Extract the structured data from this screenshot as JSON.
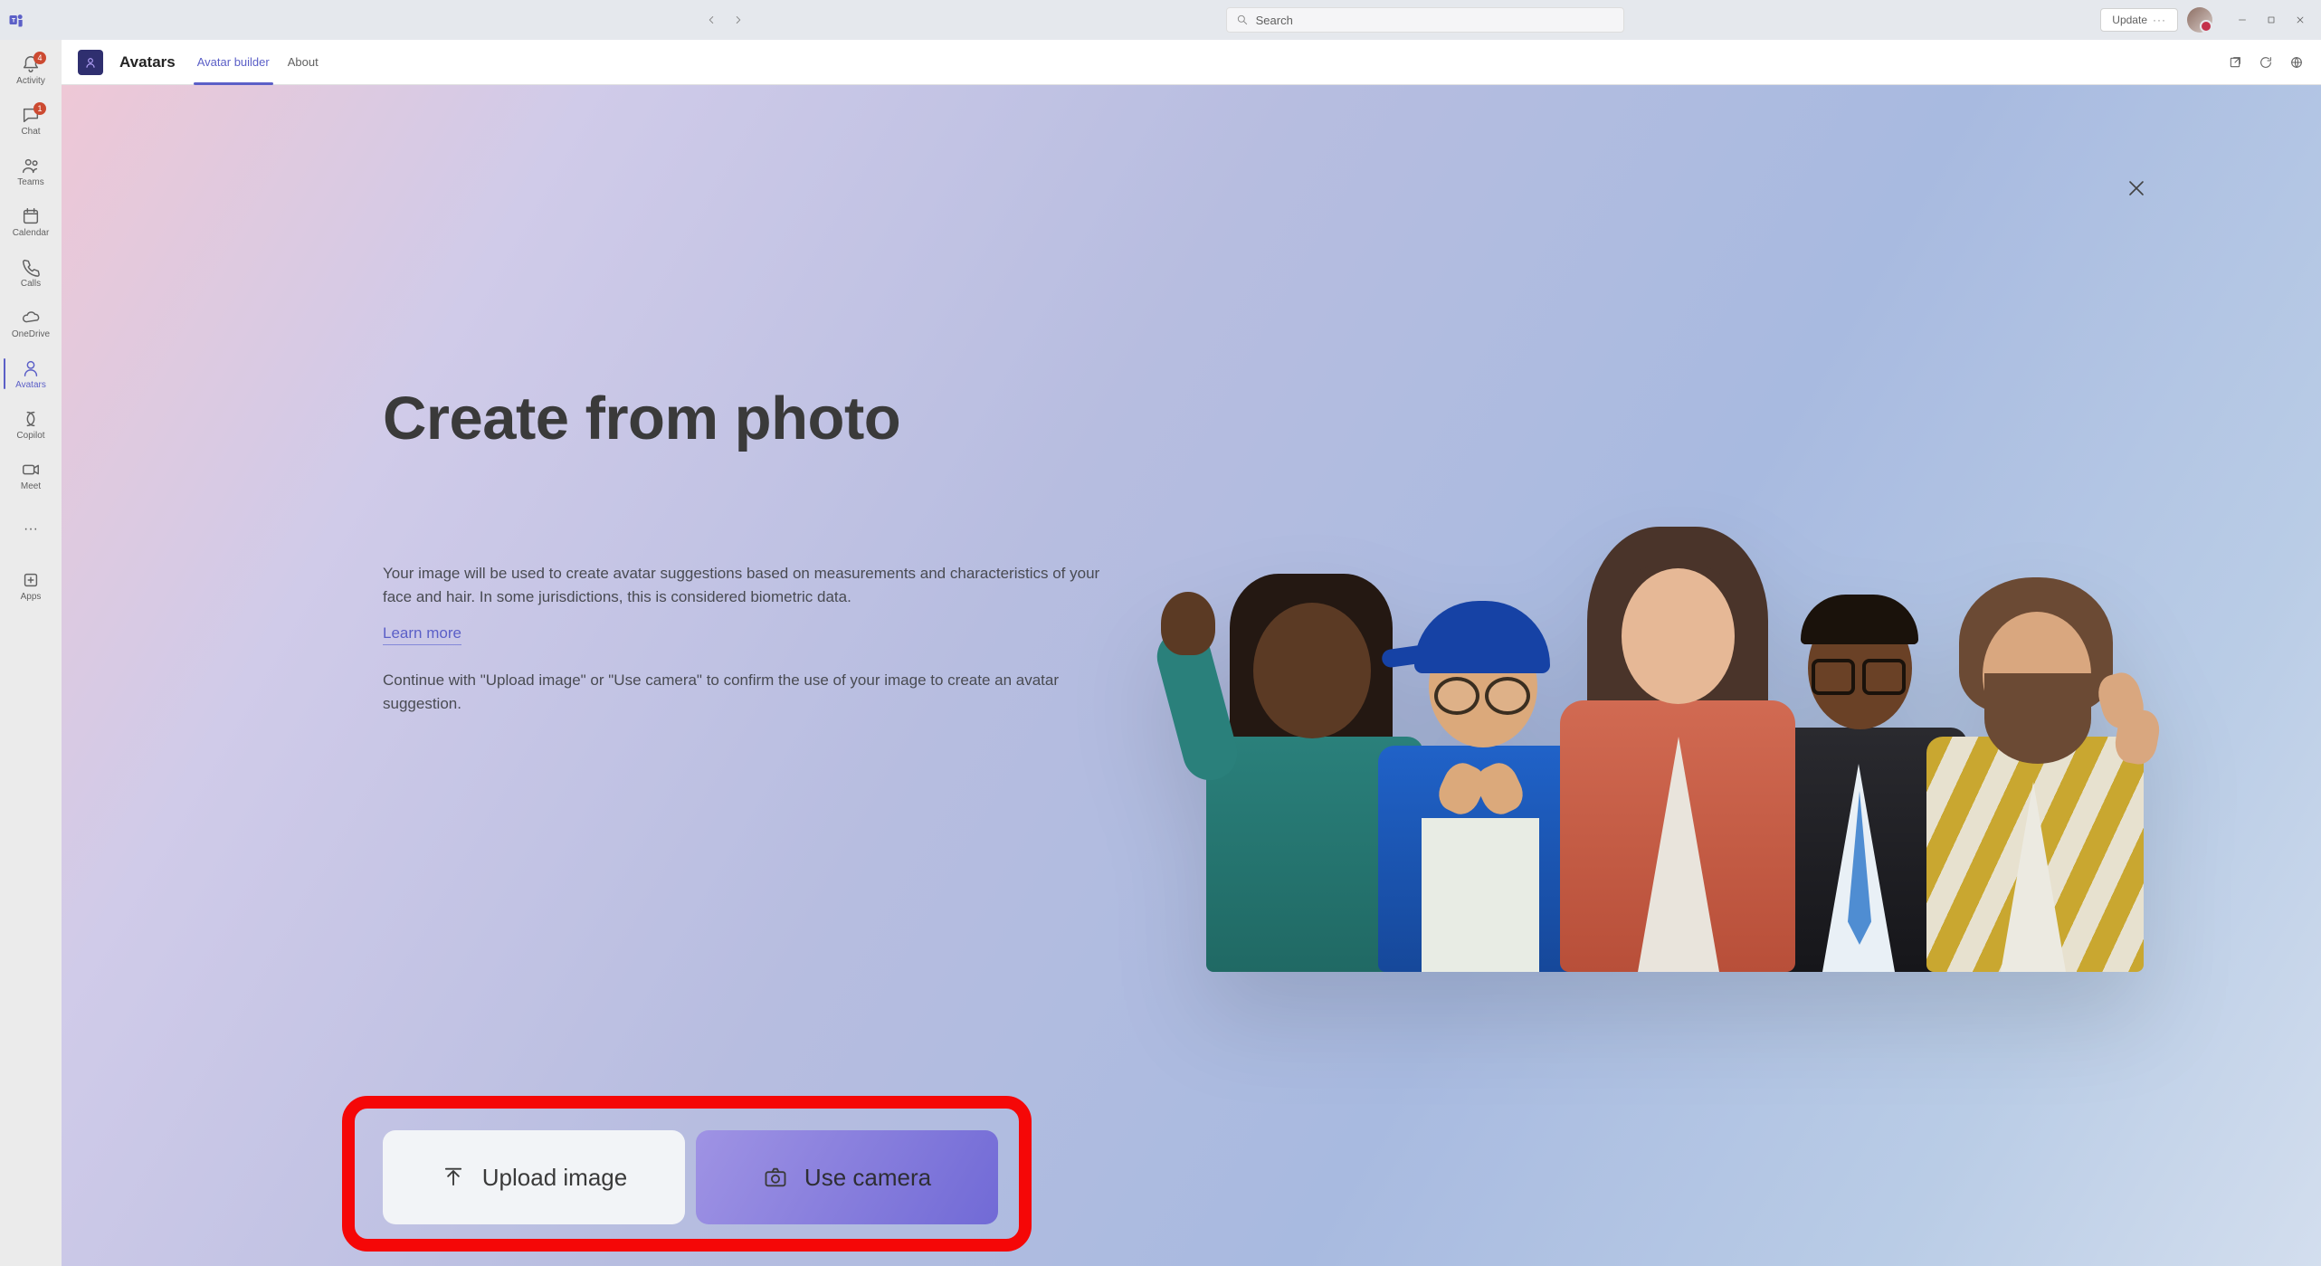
{
  "titlebar": {
    "search_placeholder": "Search",
    "update_label": "Update"
  },
  "rail": {
    "items": [
      {
        "label": "Activity",
        "badge": "4"
      },
      {
        "label": "Chat",
        "badge": "1"
      },
      {
        "label": "Teams",
        "badge": ""
      },
      {
        "label": "Calendar",
        "badge": ""
      },
      {
        "label": "Calls",
        "badge": ""
      },
      {
        "label": "OneDrive",
        "badge": ""
      },
      {
        "label": "Avatars",
        "badge": ""
      },
      {
        "label": "Copilot",
        "badge": ""
      },
      {
        "label": "Meet",
        "badge": ""
      }
    ],
    "apps_label": "Apps"
  },
  "subheader": {
    "app_title": "Avatars",
    "tabs": [
      {
        "label": "Avatar builder"
      },
      {
        "label": "About"
      }
    ]
  },
  "stage": {
    "headline": "Create from photo",
    "para1": "Your image will be used to create avatar suggestions based on measurements and characteristics of your face and hair. In some jurisdictions, this is considered biometric data.",
    "learn_more": "Learn more",
    "para2": "Continue with \"Upload image\" or \"Use camera\" to confirm the use of your image to create an avatar suggestion.",
    "upload_label": "Upload image",
    "camera_label": "Use camera"
  }
}
